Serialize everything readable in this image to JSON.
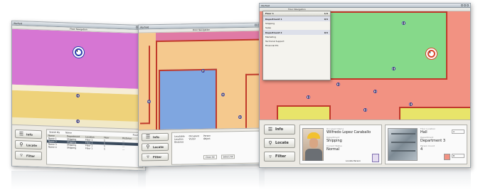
{
  "colors": {
    "pink": "#d676d3",
    "blue_zone": "#7fa6e0",
    "yellow": "#eed27a",
    "peach": "#f5c98e",
    "green": "#86d98a",
    "salmon": "#f29282",
    "dark_yellow": "#e8e46a",
    "wall": "#c0392b"
  },
  "nav_buttons": {
    "info": "Info",
    "locate": "Locate",
    "filter": "Filter"
  },
  "win1": {
    "title": "Warfield",
    "menu_left": "Floor Navigation",
    "table": {
      "headers": [
        "Name",
        "Department",
        "Location",
        "Floor",
        "Distance"
      ],
      "rows": [
        [
          "Name 1",
          "Shipping",
          "Floor 1",
          "1",
          "---"
        ],
        [
          "Name 2",
          "Shipping",
          "Floor 1",
          "1",
          "---"
        ],
        [
          "Name 3",
          "Shipping",
          "Floor 1",
          "1",
          "---"
        ],
        [
          "Name 4",
          "Shipping",
          "Floor 1",
          "1",
          "---"
        ]
      ],
      "search_label": "Search By",
      "search_value": "Name",
      "floor_label": "Floor 1"
    }
  },
  "win2": {
    "title": "Warfield",
    "menu_left": "Floor Navigation",
    "filter_items": [
      "Locatable",
      "Location",
      "Distance"
    ],
    "filter_items2": [
      "Occupant",
      "Visitor"
    ],
    "filter_items3": [
      "Person",
      "Object"
    ],
    "buttons": [
      "Clear All",
      "Select All"
    ]
  },
  "win3": {
    "title": "Warfield",
    "menu_left": "Floor Navigation",
    "dropdown": {
      "floor": "Floor 1",
      "floor_count": "1/4",
      "dept1": "Department 1",
      "dept1_count": "0/4",
      "items1": [
        "Shipping",
        "Sales"
      ],
      "dept2": "Department 2",
      "dept2_count": "0/4",
      "items2": [
        "Marketing",
        "Technical Support",
        "Financial Ed."
      ]
    },
    "person_card": {
      "label_name": "Occupant Name",
      "name": "Wilfredo Lopez Caraballo",
      "label_dept": "Department",
      "dept": "Shipping",
      "label_status": "Current Status",
      "status": "Normal",
      "button": "Locate Person"
    },
    "place_card": {
      "label_floor": "Floor Location",
      "floor": "Hall",
      "label_dept": "Department",
      "dept": "Department 3",
      "label_count": "Person Count",
      "count": "4",
      "items": [
        "A",
        "B"
      ]
    }
  }
}
